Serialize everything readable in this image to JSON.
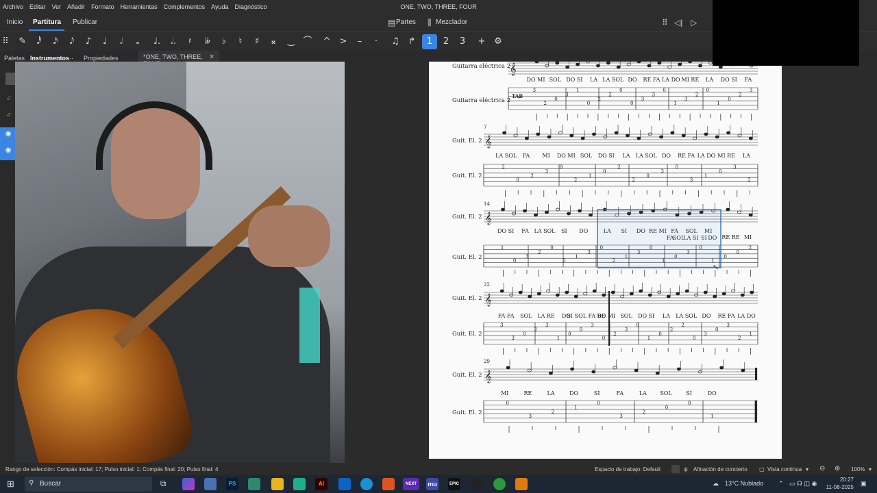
{
  "menubar": {
    "items": [
      "Archivo",
      "Editar",
      "Ver",
      "Añadir",
      "Formato",
      "Herramientas",
      "Complementos",
      "Ayuda",
      "Diagnóstico"
    ],
    "title": "ONE, TWO, THREE, FOUR"
  },
  "tabs": {
    "inicio": "Inicio",
    "partitura": "Partitura",
    "publicar": "Publicar",
    "partes": "Partes",
    "mezclador": "Mezclador"
  },
  "toolbar": {
    "icons": [
      "pencil-icon",
      "note-64th-icon",
      "note-32nd-icon",
      "note-16th-icon",
      "note-8th-icon",
      "note-quarter-icon",
      "note-half-icon",
      "note-whole-icon",
      "dotted-quarter-icon",
      "dotted-half-icon",
      "rest-icon",
      "double-flat-icon",
      "flat-icon",
      "natural-icon",
      "sharp-icon",
      "double-sharp-icon",
      "tie-icon",
      "slur-icon",
      "marcato-icon",
      "accent-icon",
      "tenuto-icon",
      "staccato-icon",
      "tuplet-icon",
      "flip-icon",
      "voice-1-icon",
      "voice-2-icon",
      "voice-3-icon",
      "add-icon",
      "settings-icon"
    ],
    "glyphs": [
      "✎",
      "𝅘𝅥𝅰",
      "𝅘𝅥𝅯",
      "𝅘𝅥𝅮",
      "♪",
      "♩",
      "𝅗𝅥",
      "𝅝",
      "♩.",
      "𝅗𝅥.",
      "𝄽",
      "𝄫",
      "♭",
      "♮",
      "♯",
      "𝄪",
      "‿",
      "⌒",
      "^",
      ">",
      "–",
      "·",
      "♫",
      "↱",
      "1",
      "2",
      "3",
      "+",
      "⚙"
    ]
  },
  "panels": {
    "paletas": "Paletas",
    "instrumentos": "Instrumentos",
    "propiedades": "Propiedades",
    "doc_tab": "*ONE, TWO, THREE, FOUR",
    "close": "×"
  },
  "score": {
    "instrument_full": "Guitarra eléctrica 2",
    "instrument_short": "Guit. El. 2",
    "measure_numbers": [
      "7",
      "14",
      "22",
      "29"
    ],
    "lyrics_row1": [
      "DO MI",
      "SOL",
      "DO SI",
      "LA",
      "LA SOL",
      "DO",
      "RE FA",
      "LA DO",
      "MI RE",
      "LA",
      "DO SI",
      "FA"
    ],
    "lyrics_row2": [
      "LA SOL",
      "FA",
      "MI",
      "DO MI",
      "SOL",
      "DO SI",
      "LA",
      "LA SOL",
      "DO",
      "RE FA",
      "LA DO",
      "MI RE",
      "LA"
    ],
    "lyrics_row3a": [
      "DO SI",
      "FA",
      "LA SOL",
      "SI",
      "DO"
    ],
    "lyrics_row3b": [
      "LA",
      "SI",
      "DO",
      "RE MI",
      "FA",
      "SOL",
      "MI"
    ],
    "lyrics_row3c": [
      "FA",
      "SOL",
      "LA",
      "SI",
      "SI",
      "DO"
    ],
    "lyrics_row3d": [
      "RE RE",
      "MI"
    ],
    "lyrics_row4": [
      "FA FA",
      "SOL",
      "LA RE",
      "DO",
      "SI SOL FA RE",
      "DO MI",
      "SOL",
      "DO SI",
      "LA",
      "LA SOL",
      "DO",
      "RE FA",
      "LA DO"
    ],
    "lyrics_row5": [
      "MI",
      "RE",
      "LA",
      "DO",
      "SI",
      "FA",
      "LA",
      "SOL",
      "SI",
      "DO"
    ],
    "tab_numbers_row1": [
      "3",
      "2",
      "0",
      "3",
      "1",
      "0",
      "2",
      "2",
      "0",
      "0",
      "3",
      "3",
      "0",
      "1",
      "3",
      "2",
      "0",
      "1",
      "0",
      "2",
      "3"
    ],
    "tab_numbers_row2": [
      "2",
      "0",
      "2",
      "3",
      "0",
      "2",
      "1",
      "0",
      "2",
      "2",
      "0",
      "3",
      "0",
      "3",
      "1",
      "0",
      "3",
      "2"
    ],
    "tab_numbers_row3": [
      "1",
      "0",
      "3",
      "2",
      "0",
      "0",
      "1",
      "3",
      "0",
      "2",
      "1",
      "3",
      "0",
      "1",
      "0",
      "3",
      "0",
      "1",
      "0",
      "0",
      "2"
    ],
    "tab_numbers_row4": [
      "3",
      "3",
      "0",
      "2",
      "3",
      "1",
      "0",
      "0",
      "3",
      "0",
      "2",
      "3",
      "0",
      "1",
      "0",
      "2",
      "2",
      "0",
      "3",
      "0",
      "3",
      "2",
      "1"
    ],
    "tab_numbers_row5": [
      "0",
      "3",
      "2",
      "1",
      "0",
      "3",
      "2",
      "0",
      "0",
      "1"
    ],
    "tab_label": "TAB"
  },
  "statusbar": {
    "selection": "Rango de selección: Compás inicial: 17; Pulso inicial: 1; Compás final: 20; Pulso final: 4",
    "workspace": "Espacio de trabajo: Default",
    "tuning": "Afinación de concierto",
    "view": "Vista continua",
    "zoom": "100%"
  },
  "taskbar": {
    "search": "Buscar",
    "weather": "13°C  Nublado",
    "time": "20:27",
    "date": "11-08-2025",
    "apps": [
      "PS",
      "AI",
      "NEXT",
      "mu",
      "EPIC"
    ]
  },
  "colors": {
    "accent": "#3b86e0",
    "selection": "#2d6fc2",
    "page": "#fafafa",
    "chrome": "#2d2d2d"
  }
}
